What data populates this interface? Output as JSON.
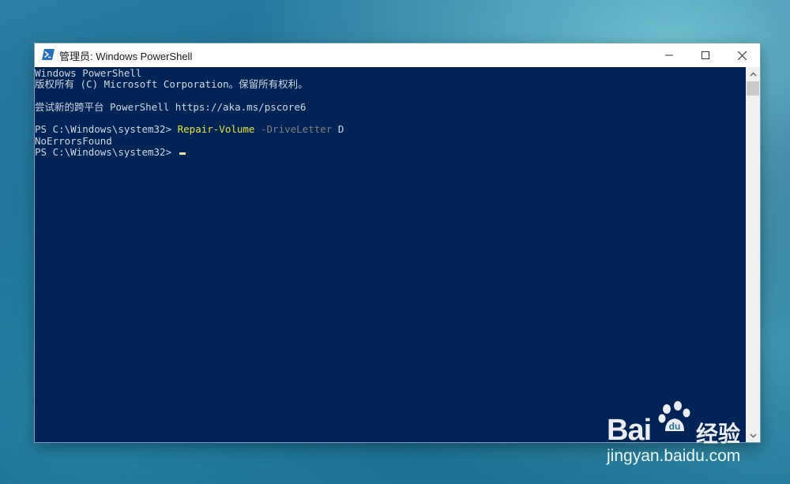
{
  "window": {
    "title": "管理员: Windows PowerShell",
    "icon": "powershell-icon",
    "controls": [
      "minimize-icon",
      "maximize-icon",
      "close-icon"
    ]
  },
  "console": {
    "lines": [
      "Windows PowerShell",
      "版权所有 (C) Microsoft Corporation。保留所有权利。",
      "",
      "尝试新的跨平台 PowerShell https://aka.ms/pscore6",
      "",
      "PS C:\\Windows\\system32> ",
      "NoErrorsFound",
      "PS C:\\Windows\\system32> "
    ],
    "command": {
      "cmdlet": "Repair-Volume",
      "parameter": "-DriveLetter",
      "argument": "D"
    }
  },
  "colors": {
    "console_bg": "#012456",
    "text": "#cfd7e2",
    "cmdlet": "#e8e23a",
    "parameter": "#808080",
    "cursor": "#eedf9c"
  },
  "watermark": {
    "brand_left": "Bai",
    "brand_right": "经验",
    "url": "jingyan.baidu.com"
  }
}
